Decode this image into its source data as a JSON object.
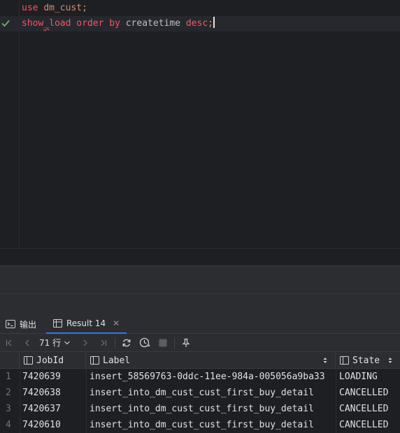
{
  "editor": {
    "lines": [
      {
        "tokens": [
          "use",
          "dm_cust",
          ";"
        ]
      },
      {
        "tokens": [
          "show",
          "_",
          "load",
          "order",
          "by",
          "createtime",
          "desc",
          ";"
        ]
      }
    ]
  },
  "tabs": {
    "output_label": "输出",
    "result_label": "Result 14"
  },
  "toolbar": {
    "rows_label": "71 行"
  },
  "grid": {
    "columns": [
      "JobId",
      "Label",
      "State"
    ],
    "rows": [
      {
        "num": "1",
        "jobid": "7420639",
        "label": "insert_58569763-0ddc-11ee-984a-005056a9ba33",
        "state": "LOADING"
      },
      {
        "num": "2",
        "jobid": "7420638",
        "label": "insert_into_dm_cust_cust_first_buy_detail",
        "state": "CANCELLED"
      },
      {
        "num": "3",
        "jobid": "7420637",
        "label": "insert_into_dm_cust_cust_first_buy_detail",
        "state": "CANCELLED"
      },
      {
        "num": "4",
        "jobid": "7420610",
        "label": "insert_into_dm_cust_cust_first_buy_detail",
        "state": "CANCELLED"
      }
    ]
  },
  "colors": {
    "keyword": "#cf8e6d",
    "error": "#f75464",
    "accent": "#3574f0",
    "success": "#5fb865"
  }
}
